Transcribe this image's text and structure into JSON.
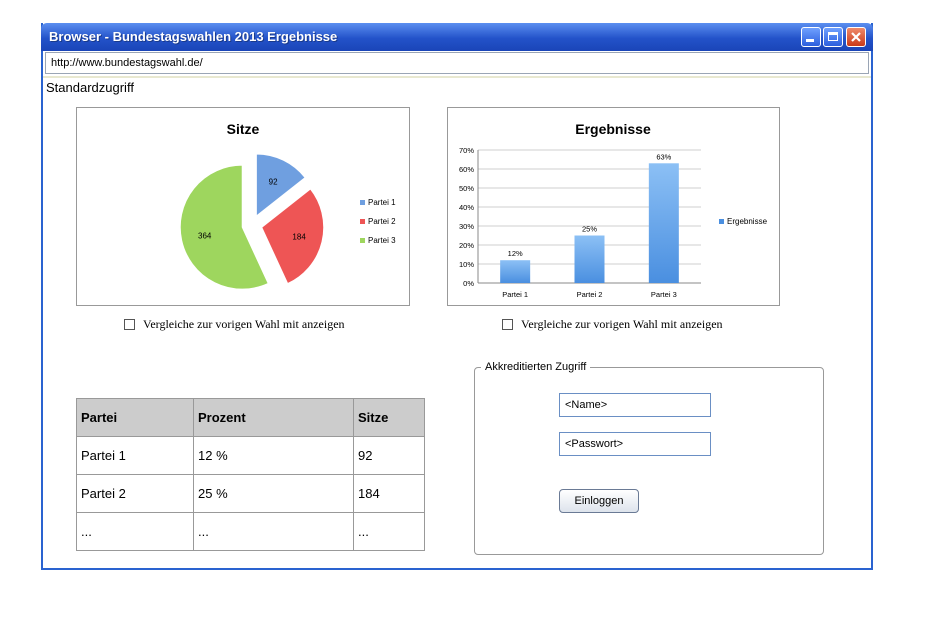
{
  "window": {
    "title": "Browser - Bundestagswahlen 2013 Ergebnisse",
    "url": "http://www.bundestagswahl.de/"
  },
  "page": {
    "heading": "Standardzugriff",
    "compare_label": "Vergleiche zur vorigen Wahl mit anzeigen"
  },
  "chart_data": [
    {
      "type": "pie",
      "title": "Sitze",
      "categories": [
        "Partei 1",
        "Partei 2",
        "Partei 3"
      ],
      "values": [
        92,
        184,
        364
      ],
      "colors": [
        "#6f9fe0",
        "#ee5555",
        "#9ed65e"
      ],
      "exploded": true,
      "legend": "right"
    },
    {
      "type": "bar",
      "title": "Ergebnisse",
      "categories": [
        "Partei 1",
        "Partei 2",
        "Partei 3"
      ],
      "series": [
        {
          "name": "Ergebnisse",
          "values": [
            12,
            25,
            63
          ]
        }
      ],
      "value_labels": [
        "12%",
        "25%",
        "63%"
      ],
      "yticks": [
        "0%",
        "10%",
        "20%",
        "30%",
        "40%",
        "50%",
        "60%",
        "70%"
      ],
      "ylim": [
        0,
        70
      ],
      "grid": true,
      "legend": "right",
      "color": "#4a8fe0"
    }
  ],
  "table": {
    "headers": [
      "Partei",
      "Prozent",
      "Sitze"
    ],
    "rows": [
      [
        "Partei 1",
        "12 %",
        "92"
      ],
      [
        "Partei 2",
        "25 %",
        "184"
      ],
      [
        "...",
        "...",
        "..."
      ]
    ]
  },
  "login": {
    "legend": "Akkreditierten Zugriff",
    "name_value": "<Name>",
    "password_value": "<Passwort>",
    "button_label": "Einloggen"
  }
}
